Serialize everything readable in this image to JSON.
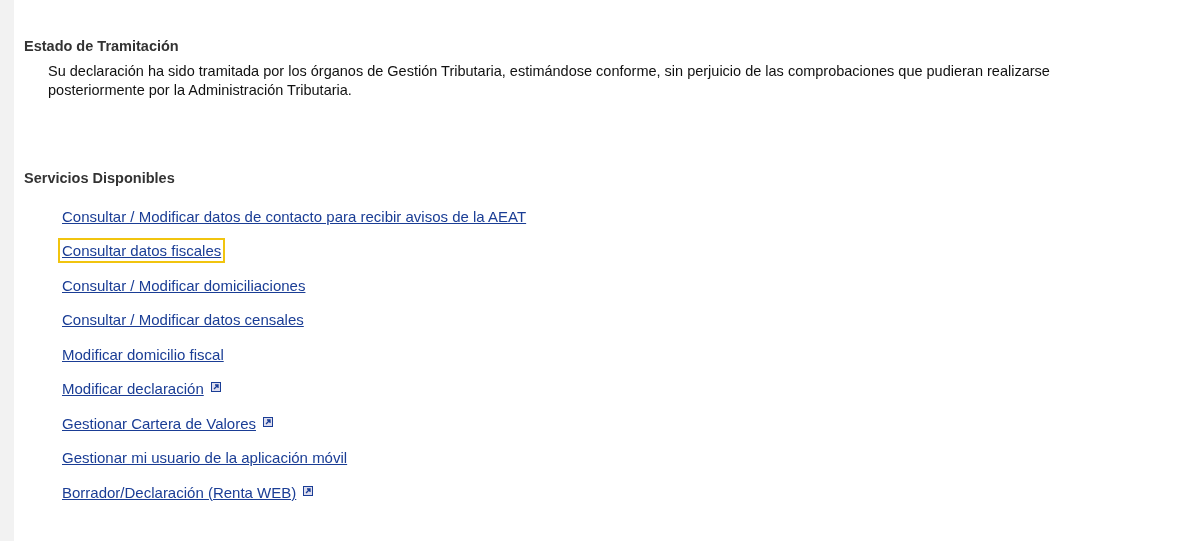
{
  "status": {
    "heading": "Estado de Tramitación",
    "text": "Su declaración ha sido tramitada por los órganos de Gestión Tributaria, estimándose conforme, sin perjuicio de las comprobaciones que pudieran realizarse posteriormente por la Administración Tributaria."
  },
  "services": {
    "heading": "Servicios Disponibles",
    "links": [
      {
        "label": "Consultar / Modificar datos de contacto para recibir avisos de la AEAT",
        "selected": false,
        "external": false
      },
      {
        "label": "Consultar datos fiscales",
        "selected": true,
        "external": false
      },
      {
        "label": "Consultar / Modificar domiciliaciones",
        "selected": false,
        "external": false
      },
      {
        "label": "Consultar / Modificar datos censales",
        "selected": false,
        "external": false
      },
      {
        "label": "Modificar domicilio fiscal",
        "selected": false,
        "external": false
      },
      {
        "label": "Modificar declaración",
        "selected": false,
        "external": true
      },
      {
        "label": "Gestionar Cartera de Valores",
        "selected": false,
        "external": true
      },
      {
        "label": "Gestionar mi usuario de la aplicación móvil",
        "selected": false,
        "external": false
      },
      {
        "label": "Borrador/Declaración (Renta WEB)",
        "selected": false,
        "external": true
      }
    ]
  }
}
